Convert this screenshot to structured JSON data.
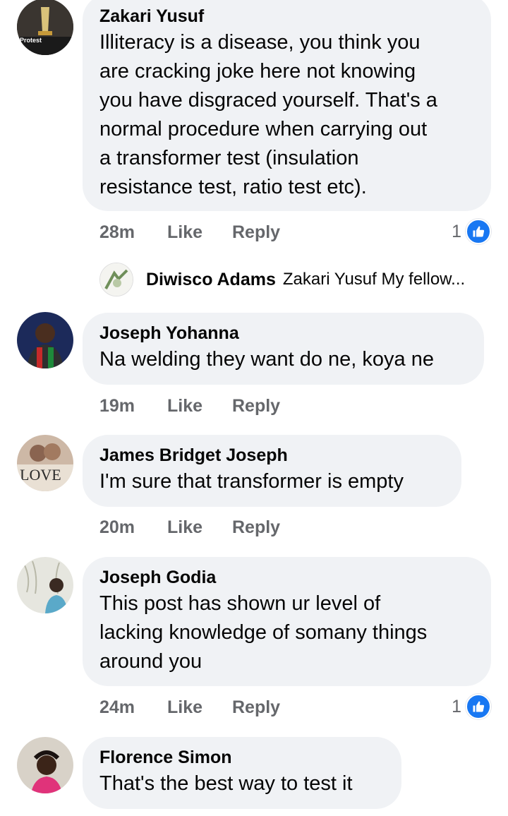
{
  "comments": [
    {
      "author": "Zakari Yusuf",
      "lines": [
        "Illiteracy is a disease, you think you",
        "are cracking joke here not knowing",
        "you have disgraced yourself. That's a",
        "normal procedure when carrying out",
        "a transformer test (insulation",
        "resistance test, ratio test etc)."
      ],
      "time": "28m",
      "like_label": "Like",
      "reply_label": "Reply",
      "reactions": "1",
      "avatar_text": "Protest"
    },
    {
      "author": "Joseph Yohanna",
      "lines": [
        "Na welding they want do ne, koya ne"
      ],
      "time": "19m",
      "like_label": "Like",
      "reply_label": "Reply"
    },
    {
      "author": "James Bridget Joseph",
      "lines": [
        "I'm sure that transformer is empty"
      ],
      "time": "20m",
      "like_label": "Like",
      "reply_label": "Reply",
      "avatar_text": "LOVE"
    },
    {
      "author": "Joseph Godia",
      "lines": [
        "This post has shown ur level of",
        "lacking knowledge of somany things",
        "around you"
      ],
      "time": "24m",
      "like_label": "Like",
      "reply_label": "Reply",
      "reactions": "1"
    },
    {
      "author": "Florence Simon",
      "lines": [
        "That's the best way to test it"
      ]
    }
  ],
  "reply_preview": {
    "author": "Diwisco Adams",
    "text": "Zakari Yusuf My fellow..."
  },
  "colors": {
    "bubble": "#f0f2f5",
    "meta": "#65676b",
    "like_blue": "#1877f2"
  }
}
